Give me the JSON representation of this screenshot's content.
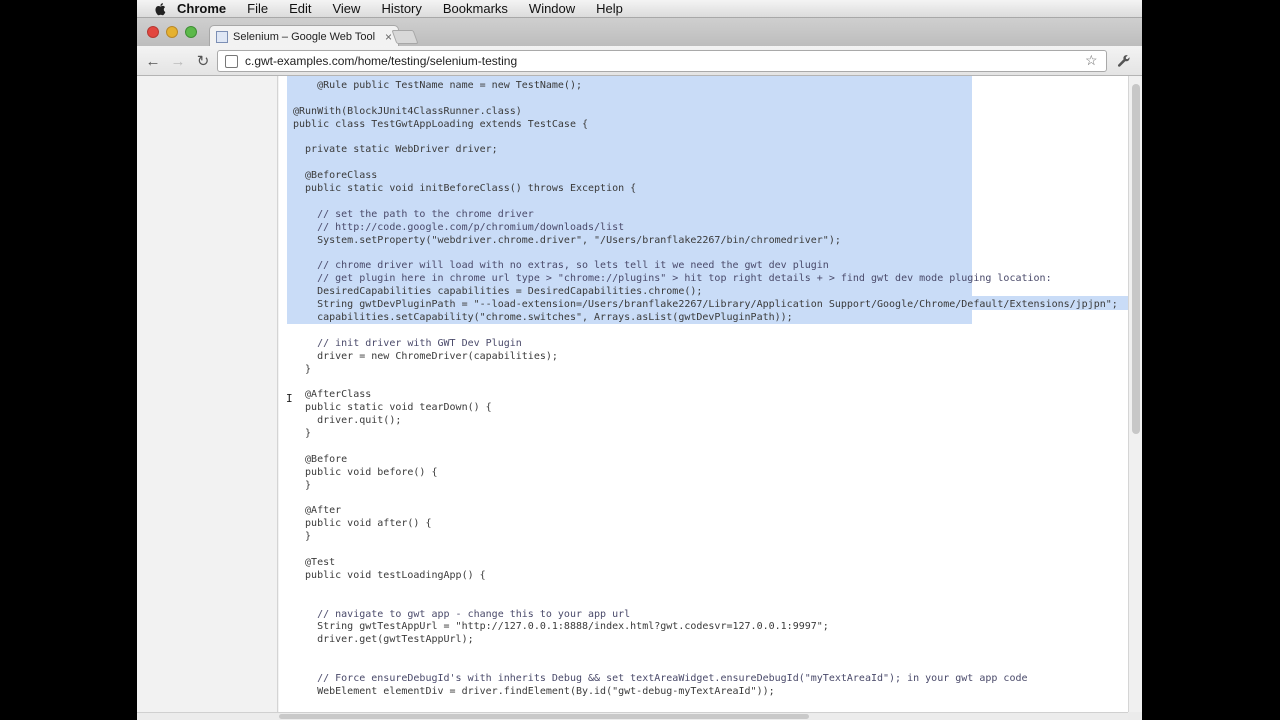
{
  "menubar": {
    "apple_icon": "apple-icon",
    "app_name": "Chrome",
    "items": [
      "File",
      "Edit",
      "View",
      "History",
      "Bookmarks",
      "Window",
      "Help"
    ]
  },
  "tab": {
    "title": "Selenium – Google Web Tool",
    "close": "×"
  },
  "toolbar": {
    "back": "←",
    "forward": "→",
    "reload": "↻",
    "url": "c.gwt-examples.com/home/testing/selenium-testing",
    "star": "☆",
    "wrench": "🔧"
  },
  "code_lines": [
    "    @Rule public TestName name = new TestName();",
    "",
    "@RunWith(BlockJUnit4ClassRunner.class)",
    "public class TestGwtAppLoading extends TestCase {",
    "",
    "  private static WebDriver driver;",
    "",
    "  @BeforeClass",
    "  public static void initBeforeClass() throws Exception {",
    "",
    "    // set the path to the chrome driver",
    "    // http://code.google.com/p/chromium/downloads/list",
    "    System.setProperty(\"webdriver.chrome.driver\", \"/Users/branflake2267/bin/chromedriver\");",
    "",
    "    // chrome driver will load with no extras, so lets tell it we need the gwt dev plugin",
    "    // get plugin here in chrome url type > \"chrome://plugins\" > hit top right details + > find gwt dev mode pluging location:",
    "    DesiredCapabilities capabilities = DesiredCapabilities.chrome();",
    "    String gwtDevPluginPath = \"--load-extension=/Users/branflake2267/Library/Application Support/Google/Chrome/Default/Extensions/jpjpn\";",
    "    capabilities.setCapability(\"chrome.switches\", Arrays.asList(gwtDevPluginPath));",
    "",
    "    // init driver with GWT Dev Plugin",
    "    driver = new ChromeDriver(capabilities);",
    "  }",
    "",
    "  @AfterClass",
    "  public static void tearDown() {",
    "    driver.quit();",
    "  }",
    "",
    "  @Before",
    "  public void before() {",
    "  }",
    "",
    "  @After",
    "  public void after() {",
    "  }",
    "",
    "  @Test",
    "  public void testLoadingApp() {",
    "",
    "",
    "    // navigate to gwt app - change this to your app url",
    "    String gwtTestAppUrl = \"http://127.0.0.1:8888/index.html?gwt.codesvr=127.0.0.1:9997\";",
    "    driver.get(gwtTestAppUrl);",
    "",
    "",
    "    // Force ensureDebugId's with inherits Debug && set textAreaWidget.ensureDebugId(\"myTextAreaId\"); in your gwt app code",
    "    WebElement elementDiv = driver.findElement(By.id(\"gwt-debug-myTextAreaId\"));"
  ],
  "cursor": "I"
}
